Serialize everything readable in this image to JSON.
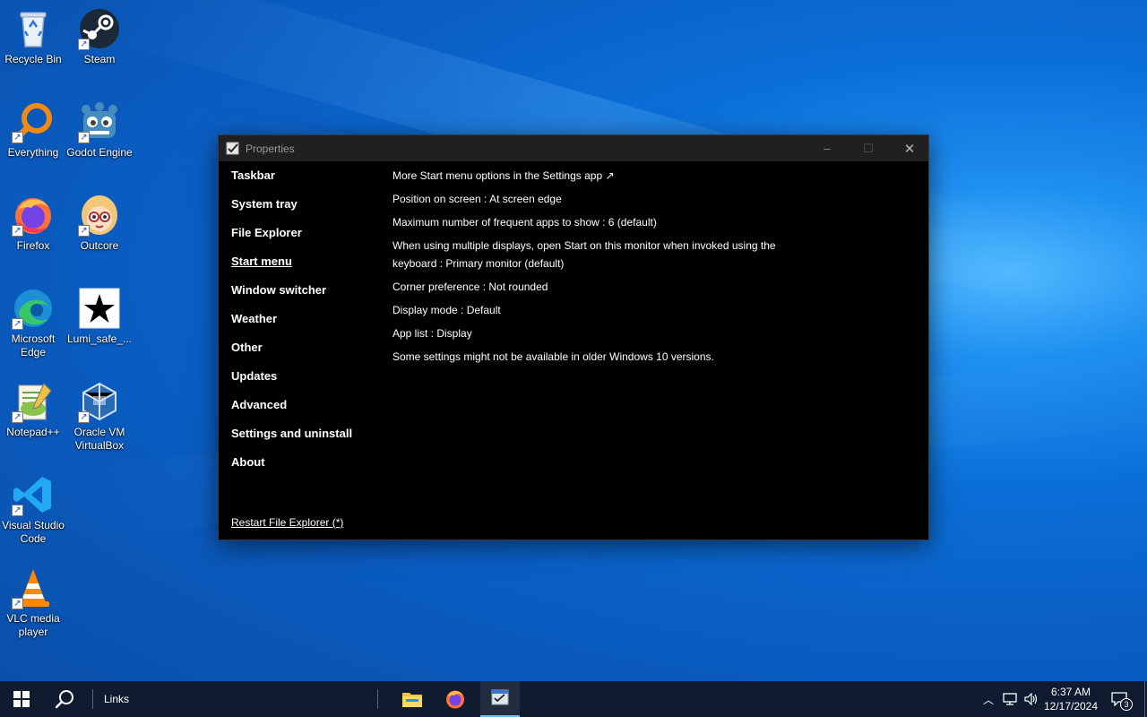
{
  "desktop": {
    "icons": [
      {
        "label": "Recycle Bin",
        "icon": "recycle-bin-icon"
      },
      {
        "label": "Steam",
        "icon": "steam-icon"
      },
      {
        "label": "Everything",
        "icon": "everything-search-icon"
      },
      {
        "label": "Godot Engine",
        "icon": "godot-icon"
      },
      {
        "label": "Firefox",
        "icon": "firefox-icon"
      },
      {
        "label": "Outcore",
        "icon": "outcore-icon"
      },
      {
        "label": "Microsoft Edge",
        "icon": "edge-icon"
      },
      {
        "label": "Lumi_safe_...",
        "icon": "star-file-icon"
      },
      {
        "label": "Notepad++",
        "icon": "notepadpp-icon"
      },
      {
        "label": "Oracle VM VirtualBox",
        "icon": "virtualbox-icon"
      },
      {
        "label": "Visual Studio Code",
        "icon": "vscode-icon"
      },
      {
        "label": "VLC media player",
        "icon": "vlc-icon"
      }
    ]
  },
  "window": {
    "title": "Properties",
    "controls": {
      "minimize": "–",
      "maximize": "☐",
      "close": "✕"
    },
    "sidebar": {
      "items": [
        {
          "label": "Taskbar",
          "active": false
        },
        {
          "label": "System tray",
          "active": false
        },
        {
          "label": "File Explorer",
          "active": false
        },
        {
          "label": "Start menu",
          "active": true
        },
        {
          "label": "Window switcher",
          "active": false
        },
        {
          "label": "Weather",
          "active": false
        },
        {
          "label": "Other",
          "active": false
        },
        {
          "label": "Updates",
          "active": false
        },
        {
          "label": "Advanced",
          "active": false
        },
        {
          "label": "Settings and uninstall",
          "active": false
        },
        {
          "label": "About",
          "active": false
        }
      ],
      "restart_link": "Restart File Explorer (*)"
    },
    "content": {
      "settings": [
        "More Start menu options in the Settings app ↗",
        "Position on screen : At screen edge",
        "Maximum number of frequent apps to show : 6 (default)",
        "When using multiple displays, open Start on this monitor when invoked using the keyboard : Primary monitor (default)",
        "Corner preference : Not rounded",
        "Display mode : Default",
        "App list : Display",
        "Some settings might not be available in older Windows 10 versions."
      ]
    }
  },
  "taskbar": {
    "links_label": "Links",
    "pinned": [
      "start-icon",
      "search-icon",
      "file-explorer-icon",
      "firefox-icon",
      "properties-app-icon"
    ],
    "clock": {
      "time": "6:37 AM",
      "date": "12/17/2024"
    },
    "notification_count": "3"
  },
  "colors": {
    "desktop_blue": "#0a5ec4",
    "window_bg": "#000000",
    "titlebar_bg": "#202020",
    "taskbar_bg": "#0f1b2e"
  }
}
